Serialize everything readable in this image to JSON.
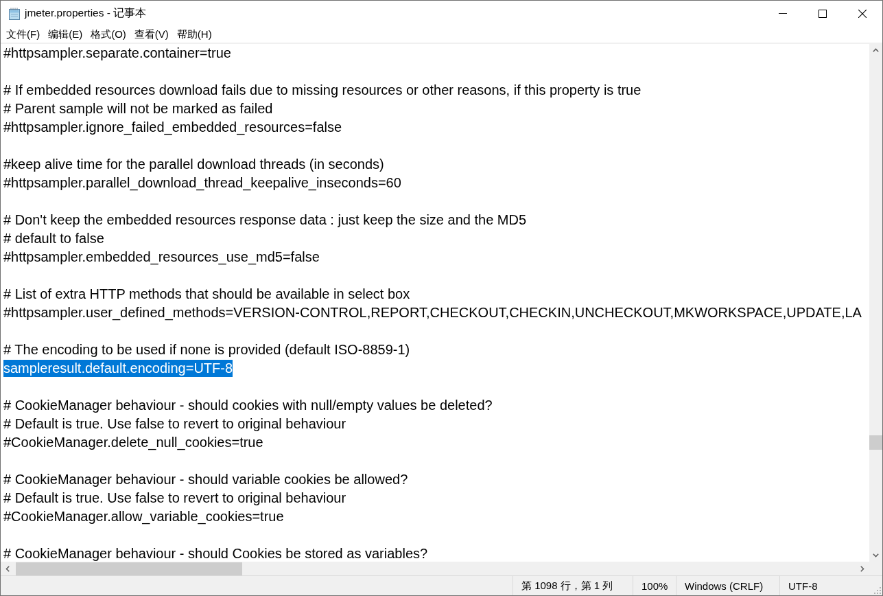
{
  "window": {
    "title": "jmeter.properties - 记事本"
  },
  "menu": [
    "文件(F)",
    "编辑(E)",
    "格式(O)",
    "查看(V)",
    "帮助(H)"
  ],
  "editor": {
    "blocks": [
      {
        "lines": [
          {
            "text": "#httpsampler.separate.container=true",
            "selected": false
          }
        ]
      },
      {
        "lines": [
          {
            "text": "# If embedded resources download fails due to missing resources or other reasons, if this property is true",
            "selected": false
          },
          {
            "text": "# Parent sample will not be marked as failed",
            "selected": false
          },
          {
            "text": "#httpsampler.ignore_failed_embedded_resources=false",
            "selected": false
          }
        ]
      },
      {
        "lines": [
          {
            "text": "#keep alive time for the parallel download threads (in seconds)",
            "selected": false
          },
          {
            "text": "#httpsampler.parallel_download_thread_keepalive_inseconds=60",
            "selected": false
          }
        ]
      },
      {
        "lines": [
          {
            "text": "# Don't keep the embedded resources response data : just keep the size and the MD5",
            "selected": false
          },
          {
            "text": "# default to false",
            "selected": false
          },
          {
            "text": "#httpsampler.embedded_resources_use_md5=false",
            "selected": false
          }
        ]
      },
      {
        "lines": [
          {
            "text": "# List of extra HTTP methods that should be available in select box",
            "selected": false
          },
          {
            "text": "#httpsampler.user_defined_methods=VERSION-CONTROL,REPORT,CHECKOUT,CHECKIN,UNCHECKOUT,MKWORKSPACE,UPDATE,LA",
            "selected": false
          }
        ]
      },
      {
        "lines": [
          {
            "text": "# The encoding to be used if none is provided (default ISO-8859-1)",
            "selected": false
          },
          {
            "text": "sampleresult.default.encoding=UTF-8",
            "selected": true
          }
        ]
      },
      {
        "lines": [
          {
            "text": "# CookieManager behaviour - should cookies with null/empty values be deleted?",
            "selected": false
          },
          {
            "text": "# Default is true. Use false to revert to original behaviour",
            "selected": false
          },
          {
            "text": "#CookieManager.delete_null_cookies=true",
            "selected": false
          }
        ]
      },
      {
        "lines": [
          {
            "text": "# CookieManager behaviour - should variable cookies be allowed?",
            "selected": false
          },
          {
            "text": "# Default is true. Use false to revert to original behaviour",
            "selected": false
          },
          {
            "text": "#CookieManager.allow_variable_cookies=true",
            "selected": false
          }
        ]
      },
      {
        "lines": [
          {
            "text": "# CookieManager behaviour - should Cookies be stored as variables?",
            "selected": false
          }
        ]
      }
    ]
  },
  "status_bar": {
    "position": "第 1098 行，第 1 列",
    "zoom": "100%",
    "line_ending": "Windows (CRLF)",
    "encoding": "UTF-8"
  }
}
